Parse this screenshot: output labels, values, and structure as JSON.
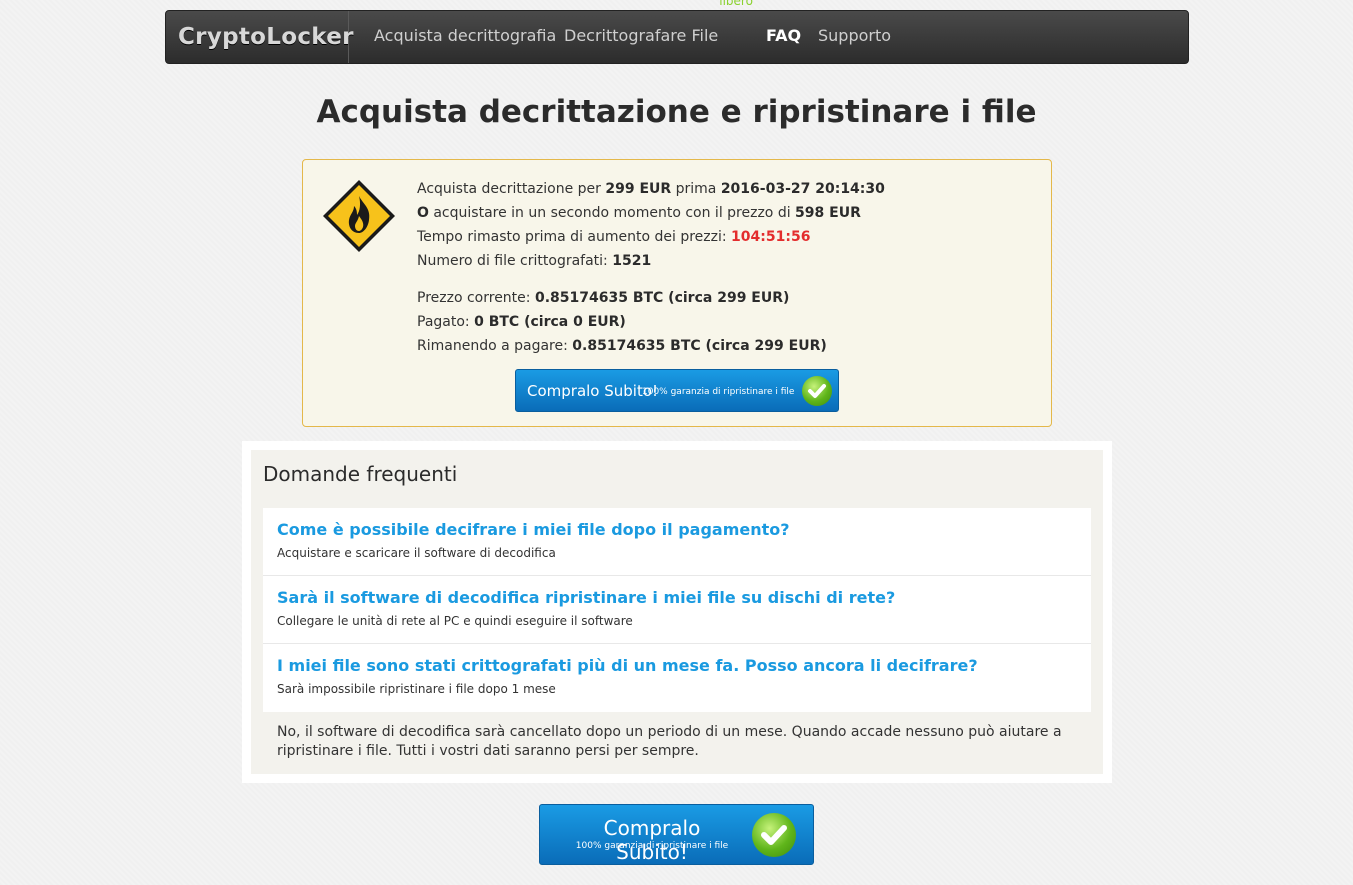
{
  "nav": {
    "brand": "CryptoLocker",
    "items": [
      {
        "label": "Acquista decrittografia",
        "sup": ""
      },
      {
        "label": "Decrittografare File",
        "sup": "libero"
      },
      {
        "label": "FAQ",
        "sup": ""
      },
      {
        "label": "Supporto",
        "sup": ""
      }
    ]
  },
  "page_title": "Acquista decrittazione e ripristinare i file",
  "payment": {
    "line1_a": "Acquista decrittazione per ",
    "line1_price": "299 EUR",
    "line1_b": " prima ",
    "line1_date": "2016-03-27 20:14:30",
    "line2_a": "O",
    "line2_b": " acquistare in un secondo momento con il prezzo di ",
    "line2_price": "598 EUR",
    "line3_a": "Tempo rimasto prima di aumento dei prezzi: ",
    "line3_timer": "104:51:56",
    "line4_a": "Numero di file crittografati: ",
    "line4_count": "1521",
    "current_label": "Prezzo corrente: ",
    "current_value": "0.85174635 BTC (circa 299 EUR)",
    "paid_label": "Pagato: ",
    "paid_value": "0 BTC (circa 0 EUR)",
    "remaining_label": "Rimanendo a pagare: ",
    "remaining_value": "0.85174635 BTC (circa 299 EUR)",
    "buy_button": "Compralo Subito!",
    "buy_button_sub": "100% garanzia di ripristinare i file"
  },
  "faq": {
    "title": "Domande frequenti",
    "items": [
      {
        "q": "Come è possibile decifrare i miei file dopo il pagamento?",
        "a": "Acquistare e scaricare il software di decodifica"
      },
      {
        "q": "Sarà il software di decodifica ripristinare i miei file su dischi di rete?",
        "a": "Collegare le unità di rete al PC e quindi eseguire il software"
      },
      {
        "q": "I miei file sono stati crittografati più di un mese fa. Posso ancora li decifrare?",
        "a": "Sarà impossibile ripristinare i file dopo 1 mese"
      }
    ],
    "note": "No, il software di decodifica sarà cancellato dopo un periodo di un mese. Quando accade nessuno può aiutare a ripristinare i file. Tutti i vostri dati saranno persi per sempre."
  },
  "bottom_button": {
    "label": "Compralo Subito!",
    "sub": "100% garanzia di ripristinare i file"
  },
  "colors": {
    "timer": "#e32d2d",
    "link": "#1a9ae0",
    "box_border": "#e4b84a",
    "button": "#0a6cb8",
    "nav_sup": "#8bd12f"
  }
}
